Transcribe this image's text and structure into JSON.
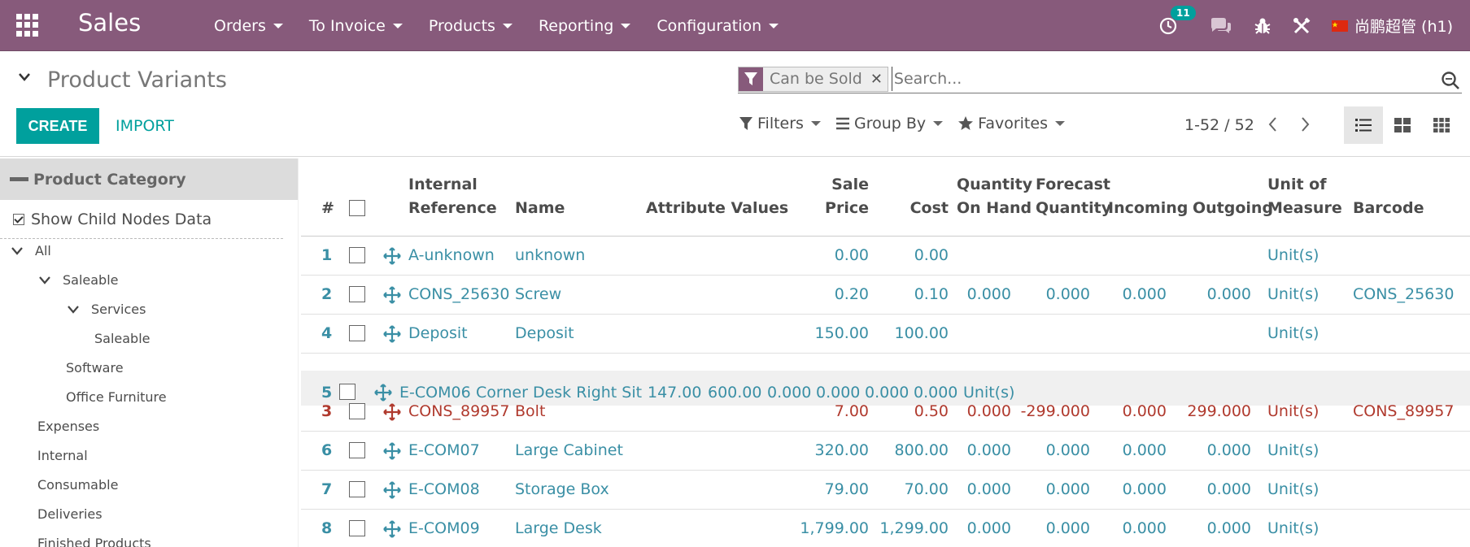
{
  "nav": {
    "brand": "Sales",
    "menu": [
      "Orders",
      "To Invoice",
      "Products",
      "Reporting",
      "Configuration"
    ],
    "activity_count": "11",
    "user": "尚鹏超管 (h1)"
  },
  "control": {
    "title": "Product Variants",
    "facet": "Can be Sold",
    "search_placeholder": "Search...",
    "create": "CREATE",
    "import": "IMPORT",
    "filters": "Filters",
    "group_by": "Group By",
    "favorites": "Favorites",
    "pager": "1-52 / 52"
  },
  "panel": {
    "header": "Product Category",
    "show_child": "Show Child Nodes Data",
    "tree": [
      "All",
      "Saleable",
      "Services",
      "Saleable",
      "Software",
      "Office Furniture",
      "Expenses",
      "Internal",
      "Consumable",
      "Deliveries",
      "Finished Products"
    ]
  },
  "table": {
    "headers": {
      "num": "#",
      "ref1": "Internal",
      "ref2": "Reference",
      "name": "Name",
      "attr": "Attribute Values",
      "sale1": "Sale",
      "sale2": "Price",
      "cost": "Cost",
      "qoh1": "Quantity",
      "qoh2": "On Hand",
      "fq1": "Forecast",
      "fq2": "Quantity",
      "incoming": "Incoming",
      "outgoing": "Outgoing",
      "uom1": "Unit of",
      "uom2": "Measure",
      "barcode": "Barcode"
    },
    "rows": [
      {
        "seq": "1",
        "ref": "A-unknown",
        "name": "unknown",
        "price": "0.00",
        "cost": "0.00",
        "qoh": "",
        "fq": "",
        "inc": "",
        "out": "",
        "uom": "Unit(s)",
        "barcode": ""
      },
      {
        "seq": "2",
        "ref": "CONS_25630",
        "name": "Screw",
        "price": "0.20",
        "cost": "0.10",
        "qoh": "0.000",
        "fq": "0.000",
        "inc": "0.000",
        "out": "0.000",
        "uom": "Unit(s)",
        "barcode": "CONS_25630"
      },
      {
        "seq": "4",
        "ref": "Deposit",
        "name": "Deposit",
        "price": "150.00",
        "cost": "100.00",
        "qoh": "",
        "fq": "",
        "inc": "",
        "out": "",
        "uom": "Unit(s)",
        "barcode": ""
      },
      {
        "seq": "3",
        "ref": "CONS_89957",
        "name": "Bolt",
        "price": "7.00",
        "cost": "0.50",
        "qoh": "0.000",
        "fq": "-299.000",
        "inc": "0.000",
        "out": "299.000",
        "uom": "Unit(s)",
        "barcode": "CONS_89957"
      },
      {
        "seq": "6",
        "ref": "E-COM07",
        "name": "Large Cabinet",
        "price": "320.00",
        "cost": "800.00",
        "qoh": "0.000",
        "fq": "0.000",
        "inc": "0.000",
        "out": "0.000",
        "uom": "Unit(s)",
        "barcode": ""
      },
      {
        "seq": "7",
        "ref": "E-COM08",
        "name": "Storage Box",
        "price": "79.00",
        "cost": "70.00",
        "qoh": "0.000",
        "fq": "0.000",
        "inc": "0.000",
        "out": "0.000",
        "uom": "Unit(s)",
        "barcode": ""
      },
      {
        "seq": "8",
        "ref": "E-COM09",
        "name": "Large Desk",
        "price": "1,799.00",
        "cost": "1,299.00",
        "qoh": "0.000",
        "fq": "0.000",
        "inc": "0.000",
        "out": "0.000",
        "uom": "Unit(s)",
        "barcode": ""
      }
    ],
    "dragged": {
      "seq": "5",
      "ref": "E-COM06",
      "name": "Corner Desk Right Sit",
      "price": "147.00",
      "cost": "600.00",
      "qoh": "0.000",
      "fq": "0.000",
      "inc": "0.000",
      "out": "0.000",
      "uom": "Unit(s)"
    }
  }
}
